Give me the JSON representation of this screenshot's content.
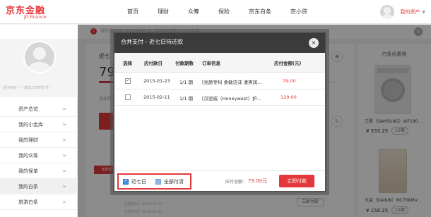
{
  "brand": {
    "name": "京东金融",
    "subtitle": "JD Finance"
  },
  "nav": {
    "items": [
      "首页",
      "理财",
      "众筹",
      "保险",
      "京东白条",
      "京小贷"
    ]
  },
  "user": {
    "account_label": "我的资产"
  },
  "notice": {
    "icon": "!",
    "text": "尊敬的用户，您已开通白条…购物时享受30天免息期…"
  },
  "profile": {
    "hint": "還你拥有一个健康华丽的账号！"
  },
  "sidebar": {
    "items": [
      {
        "label": "资产总览"
      },
      {
        "label": "我的小金库"
      },
      {
        "label": "我的理财"
      },
      {
        "label": "我的众筹"
      },
      {
        "label": "我的保单"
      },
      {
        "label": "我的白条"
      },
      {
        "label": "旅游白条"
      }
    ]
  },
  "background": {
    "title_fragment": "近七",
    "amount_fragment": "79",
    "subtitle_fragment": "全部待",
    "tab_label": "还款中",
    "item_dates": [
      "还款时间：2014-12-24",
      "还款时间：2015-01-23"
    ],
    "pay_button": "立即付款"
  },
  "right": {
    "title": "白条优惠购",
    "product1_name": "三星（SAMSUNG）WF180...",
    "product1_price": "¥ 333.25",
    "product1_term": "12期",
    "product2_name": "大金（DAIKIN）MC70KMV...",
    "product2_price": "¥ 158.25",
    "product2_term": "12期"
  },
  "modal": {
    "title": "合并支付 - 近七日待还款",
    "close": "×",
    "headers": [
      "选择",
      "应付款日",
      "付款期数",
      "订单信息",
      "应付金额(元)"
    ],
    "rows": [
      {
        "checked": true,
        "date": "2015-01-23",
        "period": "1/1 期",
        "order": "[兆颜专科 柔敏洁沫 清爽润...",
        "amount": "79.00"
      },
      {
        "checked": false,
        "date": "2015-02-11",
        "period": "1/1 期",
        "order": "[汉密威（Honeywest）护...",
        "amount": "129.00"
      }
    ],
    "footer": {
      "filter_recent_label": "近七日",
      "filter_all_label": "全部付清",
      "total_label": "应付总额：",
      "total_value": "79.00元",
      "pay_button": "立即付款"
    }
  },
  "colors": {
    "accent": "#e4393c",
    "modal_header": "#3b3b3b",
    "checkbox_blue": "#3f8ee0"
  }
}
